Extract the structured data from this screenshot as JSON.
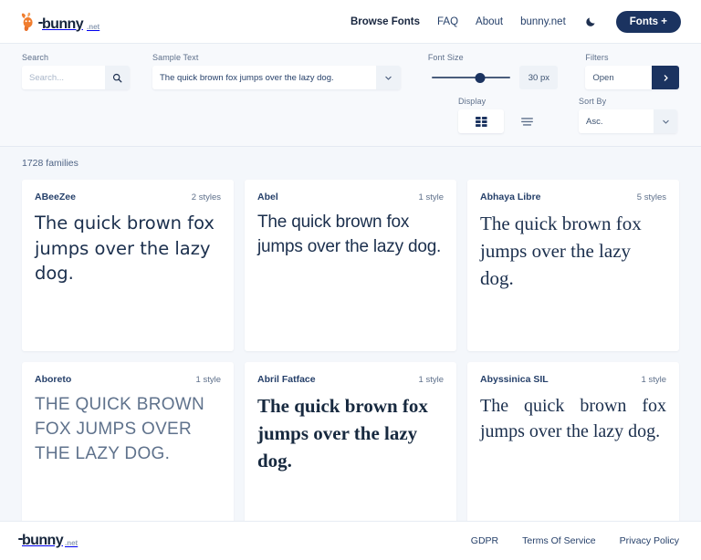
{
  "header": {
    "logo": {
      "word": "bunny",
      "tld": ".net",
      "icon": "bunny-mascot-icon"
    },
    "nav": [
      {
        "label": "Browse Fonts",
        "active": true
      },
      {
        "label": "FAQ",
        "active": false
      },
      {
        "label": "About",
        "active": false
      },
      {
        "label": "bunny.net",
        "active": false
      }
    ],
    "dark_mode_icon": "moon-icon",
    "cta_label": "Fonts +"
  },
  "controls": {
    "search": {
      "label": "Search",
      "value": "",
      "placeholder": "Search...",
      "button_icon": "search-icon"
    },
    "sample_text": {
      "label": "Sample Text",
      "value": "The quick brown fox jumps over the lazy dog.",
      "button_icon": "chevron-down-icon"
    },
    "font_size": {
      "label": "Font Size",
      "value": "30 px",
      "slider_percent": 60
    },
    "filters": {
      "label": "Filters",
      "value": "Open",
      "button_icon": "chevron-right-icon"
    },
    "display": {
      "label": "Display",
      "options": [
        {
          "icon": "grid-view-icon",
          "selected": true
        },
        {
          "icon": "list-view-icon",
          "selected": false
        }
      ]
    },
    "sort_by": {
      "label": "Sort By",
      "value": "Asc.",
      "button_icon": "chevron-down-icon"
    }
  },
  "results": {
    "count_label": "1728 families",
    "cards": [
      {
        "name": "ABeeZee",
        "styles": "2 styles",
        "preview": "The quick brown fox jumps over the lazy dog."
      },
      {
        "name": "Abel",
        "styles": "1 style",
        "preview": "The quick brown fox jumps over the lazy dog."
      },
      {
        "name": "Abhaya Libre",
        "styles": "5 styles",
        "preview": "The quick brown fox jumps over the lazy dog."
      },
      {
        "name": "Aboreto",
        "styles": "1 style",
        "preview": "The quick brown fox jumps over the lazy dog."
      },
      {
        "name": "Abril Fatface",
        "styles": "1 style",
        "preview": "The quick brown fox jumps over the lazy dog."
      },
      {
        "name": "Abyssinica SIL",
        "styles": "1 style",
        "preview": "The quick brown fox jumps over the lazy dog."
      }
    ]
  },
  "footer": {
    "logo": {
      "word": "bunny",
      "tld": ".net"
    },
    "links": [
      {
        "label": "GDPR"
      },
      {
        "label": "Terms Of Service"
      },
      {
        "label": "Privacy Policy"
      }
    ]
  },
  "colors": {
    "brand_navy": "#1b3360",
    "accent_orange": "#f07d2e",
    "page_bg": "#f4f7fb",
    "card_bg": "#ffffff",
    "text_primary": "#1e3050",
    "text_muted": "#5d6f8a"
  }
}
